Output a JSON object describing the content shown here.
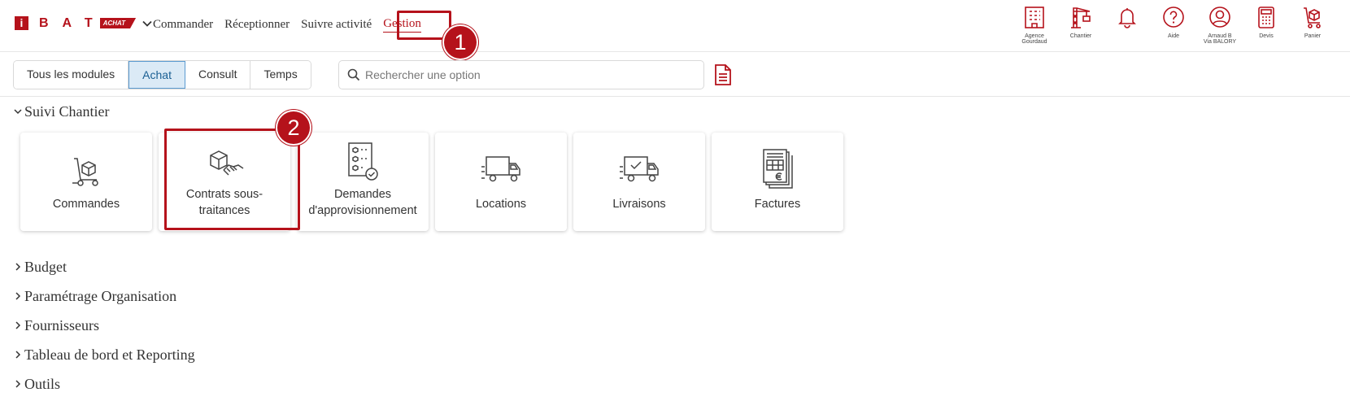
{
  "brand": {
    "logo_letter": "i",
    "logo_word": "BAT",
    "logo_tag": "ACHAT"
  },
  "nav": [
    {
      "label": "Commander"
    },
    {
      "label": "Réceptionner"
    },
    {
      "label": "Suivre activité"
    },
    {
      "label": "Gestion",
      "active": true
    }
  ],
  "badges": {
    "step1": "1",
    "step2": "2"
  },
  "right_icons": [
    {
      "icon": "building-icon",
      "label": "Agence\nGourdaud"
    },
    {
      "icon": "crane-icon",
      "label": "Chantier"
    },
    {
      "icon": "bell-icon",
      "label": ""
    },
    {
      "icon": "help-icon",
      "label": "Aide"
    },
    {
      "icon": "user-icon",
      "label": "Arnaud B\nVia BALORY"
    },
    {
      "icon": "calculator-icon",
      "label": "Devis"
    },
    {
      "icon": "cart-icon",
      "label": "Panier"
    }
  ],
  "modules": [
    {
      "label": "Tous les modules"
    },
    {
      "label": "Achat",
      "active": true
    },
    {
      "label": "Consult"
    },
    {
      "label": "Temps"
    }
  ],
  "search": {
    "placeholder": "Rechercher une option",
    "value": ""
  },
  "section_open": {
    "title": "Suivi Chantier"
  },
  "cards": [
    {
      "icon": "trolley-box-icon",
      "label": "Commandes"
    },
    {
      "icon": "handshake-box-icon",
      "label": "Contrats sous-traitances"
    },
    {
      "icon": "checklist-icon",
      "label": "Demandes d'approvisionnement"
    },
    {
      "icon": "truck-icon",
      "label": "Locations"
    },
    {
      "icon": "truck-check-icon",
      "label": "Livraisons"
    },
    {
      "icon": "invoice-icon",
      "label": "Factures"
    }
  ],
  "sections_collapsed": [
    {
      "title": "Budget"
    },
    {
      "title": "Paramétrage Organisation"
    },
    {
      "title": "Fournisseurs"
    },
    {
      "title": "Tableau de bord et Reporting"
    },
    {
      "title": "Outils"
    }
  ],
  "colors": {
    "brand_red": "#b5121b",
    "active_tab_bg": "#dbeaf6",
    "active_tab_border": "#5b9bd1"
  }
}
